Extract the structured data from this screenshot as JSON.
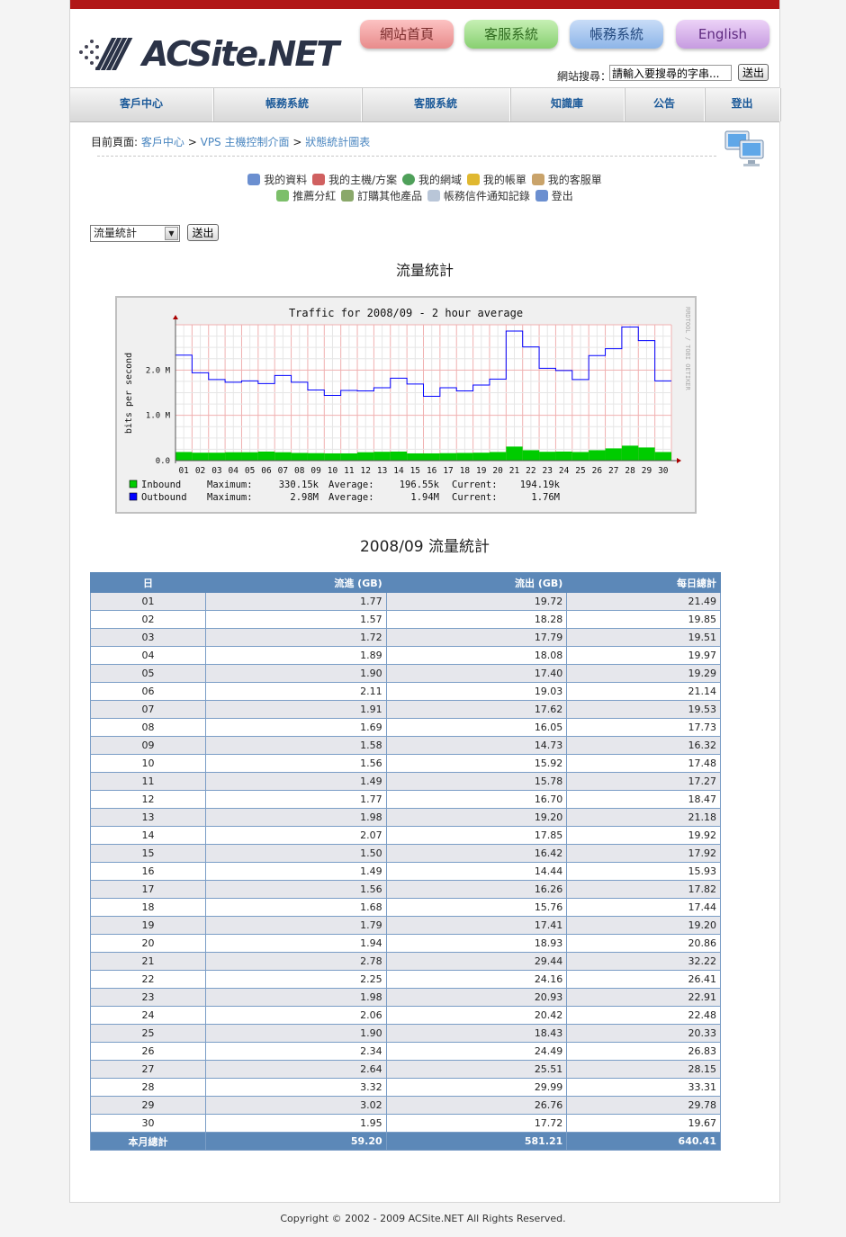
{
  "header": {
    "logo_text": "ACSite.NET",
    "pills": [
      "網站首頁",
      "客服系統",
      "帳務系統",
      "English"
    ],
    "search_label": "網站搜尋：",
    "search_placeholder": "請輸入要搜尋的字串...",
    "search_button": "送出"
  },
  "nav": [
    "客戶中心",
    "帳務系統",
    "客服系統",
    "知識庫",
    "公告",
    "登出"
  ],
  "breadcrumb": {
    "prefix": "目前頁面:",
    "items": [
      "客戶中心",
      "VPS 主機控制介面",
      "狀態統計圖表"
    ],
    "separator": ">"
  },
  "quick_links": {
    "row1": [
      "我的資料",
      "我的主機/方案",
      "我的網域",
      "我的帳單",
      "我的客服單"
    ],
    "row2": [
      "推薦分紅",
      "訂購其他產品",
      "帳務信件通知記錄",
      "登出"
    ]
  },
  "form": {
    "select_value": "流量統計",
    "submit": "送出"
  },
  "section_title": "流量統計",
  "chart_data": {
    "type": "area",
    "title": "Traffic for 2008/09 - 2 hour average",
    "ylabel": "bits per second",
    "side_text": "RRDTOOL / TOBI OETIKER",
    "x": [
      "01",
      "02",
      "03",
      "04",
      "05",
      "06",
      "07",
      "08",
      "09",
      "10",
      "11",
      "12",
      "13",
      "14",
      "15",
      "16",
      "17",
      "18",
      "19",
      "20",
      "21",
      "22",
      "23",
      "24",
      "25",
      "26",
      "27",
      "28",
      "29",
      "30"
    ],
    "yticks": [
      "0.0",
      "1.0 M",
      "2.0 M"
    ],
    "ylim": [
      0,
      3000000
    ],
    "grid": true,
    "series": [
      {
        "name": "Inbound",
        "color": "#00cc00",
        "values": [
          190000,
          175000,
          175000,
          185000,
          185000,
          200000,
          185000,
          170000,
          165000,
          160000,
          160000,
          185000,
          195000,
          200000,
          160000,
          160000,
          165000,
          170000,
          175000,
          190000,
          310000,
          230000,
          195000,
          200000,
          190000,
          230000,
          270000,
          330000,
          290000,
          190000
        ]
      },
      {
        "name": "Outbound",
        "color": "#0000ff",
        "values": [
          2330000,
          1940000,
          1790000,
          1730000,
          1760000,
          1700000,
          1880000,
          1730000,
          1560000,
          1440000,
          1550000,
          1540000,
          1610000,
          1820000,
          1690000,
          1420000,
          1610000,
          1540000,
          1670000,
          1800000,
          2860000,
          2510000,
          2040000,
          1990000,
          1790000,
          2320000,
          2470000,
          2950000,
          2650000,
          1760000
        ]
      }
    ],
    "legend": [
      {
        "name": "Inbound",
        "color": "#00cc00",
        "maximum": "330.15k",
        "average": "196.55k",
        "current": "194.19k"
      },
      {
        "name": "Outbound",
        "color": "#0000ff",
        "maximum": "2.98M",
        "average": "1.94M",
        "current": "1.76M"
      }
    ],
    "legend_labels": {
      "maximum": "Maximum:",
      "average": "Average:",
      "current": "Current:"
    }
  },
  "table": {
    "title": "2008/09 流量統計",
    "headers": [
      "日",
      "流進 (GB)",
      "流出 (GB)",
      "每日總計"
    ],
    "rows": [
      [
        "01",
        "1.77",
        "19.72",
        "21.49"
      ],
      [
        "02",
        "1.57",
        "18.28",
        "19.85"
      ],
      [
        "03",
        "1.72",
        "17.79",
        "19.51"
      ],
      [
        "04",
        "1.89",
        "18.08",
        "19.97"
      ],
      [
        "05",
        "1.90",
        "17.40",
        "19.29"
      ],
      [
        "06",
        "2.11",
        "19.03",
        "21.14"
      ],
      [
        "07",
        "1.91",
        "17.62",
        "19.53"
      ],
      [
        "08",
        "1.69",
        "16.05",
        "17.73"
      ],
      [
        "09",
        "1.58",
        "14.73",
        "16.32"
      ],
      [
        "10",
        "1.56",
        "15.92",
        "17.48"
      ],
      [
        "11",
        "1.49",
        "15.78",
        "17.27"
      ],
      [
        "12",
        "1.77",
        "16.70",
        "18.47"
      ],
      [
        "13",
        "1.98",
        "19.20",
        "21.18"
      ],
      [
        "14",
        "2.07",
        "17.85",
        "19.92"
      ],
      [
        "15",
        "1.50",
        "16.42",
        "17.92"
      ],
      [
        "16",
        "1.49",
        "14.44",
        "15.93"
      ],
      [
        "17",
        "1.56",
        "16.26",
        "17.82"
      ],
      [
        "18",
        "1.68",
        "15.76",
        "17.44"
      ],
      [
        "19",
        "1.79",
        "17.41",
        "19.20"
      ],
      [
        "20",
        "1.94",
        "18.93",
        "20.86"
      ],
      [
        "21",
        "2.78",
        "29.44",
        "32.22"
      ],
      [
        "22",
        "2.25",
        "24.16",
        "26.41"
      ],
      [
        "23",
        "1.98",
        "20.93",
        "22.91"
      ],
      [
        "24",
        "2.06",
        "20.42",
        "22.48"
      ],
      [
        "25",
        "1.90",
        "18.43",
        "20.33"
      ],
      [
        "26",
        "2.34",
        "24.49",
        "26.83"
      ],
      [
        "27",
        "2.64",
        "25.51",
        "28.15"
      ],
      [
        "28",
        "3.32",
        "29.99",
        "33.31"
      ],
      [
        "29",
        "3.02",
        "26.76",
        "29.78"
      ],
      [
        "30",
        "1.95",
        "17.72",
        "19.67"
      ]
    ],
    "total": [
      "本月總計",
      "59.20",
      "581.21",
      "640.41"
    ]
  },
  "footer": "Copyright © 2002 - 2009 ACSite.NET All Rights Reserved."
}
